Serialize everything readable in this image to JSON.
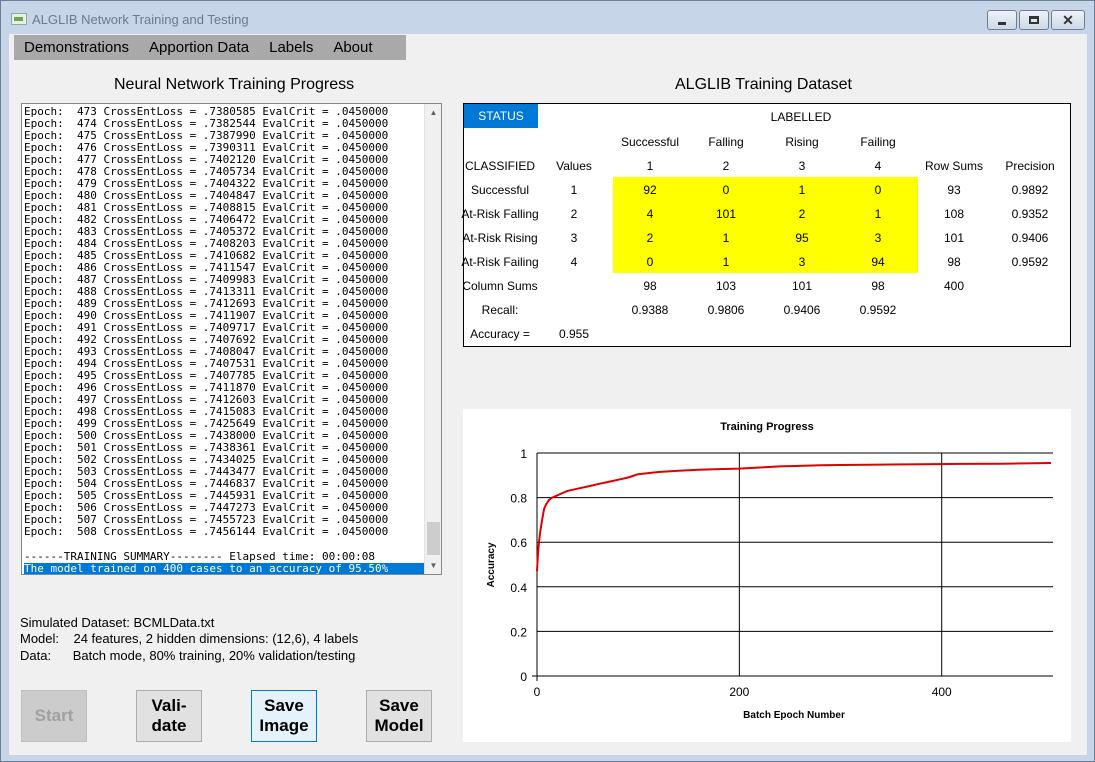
{
  "window": {
    "title": "ALGLIB Network Training and Testing"
  },
  "menu": [
    "Demonstrations",
    "Apportion Data",
    "Labels",
    "About"
  ],
  "left_heading": "Neural Network Training Progress",
  "right_heading": "ALGLIB Training Dataset",
  "log": {
    "lines": [
      "Epoch:  473 CrossEntLoss = .7380585 EvalCrit = .0450000",
      "Epoch:  474 CrossEntLoss = .7382544 EvalCrit = .0450000",
      "Epoch:  475 CrossEntLoss = .7387990 EvalCrit = .0450000",
      "Epoch:  476 CrossEntLoss = .7390311 EvalCrit = .0450000",
      "Epoch:  477 CrossEntLoss = .7402120 EvalCrit = .0450000",
      "Epoch:  478 CrossEntLoss = .7405734 EvalCrit = .0450000",
      "Epoch:  479 CrossEntLoss = .7404322 EvalCrit = .0450000",
      "Epoch:  480 CrossEntLoss = .7404847 EvalCrit = .0450000",
      "Epoch:  481 CrossEntLoss = .7408815 EvalCrit = .0450000",
      "Epoch:  482 CrossEntLoss = .7406472 EvalCrit = .0450000",
      "Epoch:  483 CrossEntLoss = .7405372 EvalCrit = .0450000",
      "Epoch:  484 CrossEntLoss = .7408203 EvalCrit = .0450000",
      "Epoch:  485 CrossEntLoss = .7410682 EvalCrit = .0450000",
      "Epoch:  486 CrossEntLoss = .7411547 EvalCrit = .0450000",
      "Epoch:  487 CrossEntLoss = .7409983 EvalCrit = .0450000",
      "Epoch:  488 CrossEntLoss = .7413311 EvalCrit = .0450000",
      "Epoch:  489 CrossEntLoss = .7412693 EvalCrit = .0450000",
      "Epoch:  490 CrossEntLoss = .7411907 EvalCrit = .0450000",
      "Epoch:  491 CrossEntLoss = .7409717 EvalCrit = .0450000",
      "Epoch:  492 CrossEntLoss = .7407692 EvalCrit = .0450000",
      "Epoch:  493 CrossEntLoss = .7408047 EvalCrit = .0450000",
      "Epoch:  494 CrossEntLoss = .7407531 EvalCrit = .0450000",
      "Epoch:  495 CrossEntLoss = .7407785 EvalCrit = .0450000",
      "Epoch:  496 CrossEntLoss = .7411870 EvalCrit = .0450000",
      "Epoch:  497 CrossEntLoss = .7412603 EvalCrit = .0450000",
      "Epoch:  498 CrossEntLoss = .7415083 EvalCrit = .0450000",
      "Epoch:  499 CrossEntLoss = .7425649 EvalCrit = .0450000",
      "Epoch:  500 CrossEntLoss = .7438000 EvalCrit = .0450000",
      "Epoch:  501 CrossEntLoss = .7438361 EvalCrit = .0450000",
      "Epoch:  502 CrossEntLoss = .7434025 EvalCrit = .0450000",
      "Epoch:  503 CrossEntLoss = .7443477 EvalCrit = .0450000",
      "Epoch:  504 CrossEntLoss = .7446837 EvalCrit = .0450000",
      "Epoch:  505 CrossEntLoss = .7445931 EvalCrit = .0450000",
      "Epoch:  506 CrossEntLoss = .7447273 EvalCrit = .0450000",
      "Epoch:  507 CrossEntLoss = .7455723 EvalCrit = .0450000",
      "Epoch:  508 CrossEntLoss = .7456144 EvalCrit = .0450000"
    ],
    "summary": "------TRAINING SUMMARY-------- Elapsed time: 00:00:08",
    "selected": "The model trained on 400 cases to an accuracy of 95.50%"
  },
  "info": {
    "dataset": "Simulated Dataset: BCMLData.txt",
    "model": "Model:    24 features, 2 hidden dimensions: (12,6), 4 labels",
    "data": "Data:      Batch mode, 80% training, 20% validation/testing"
  },
  "buttons": {
    "start": "Start",
    "validate": [
      "Vali-",
      "date"
    ],
    "save_image": [
      "Save",
      "Image"
    ],
    "save_model": [
      "Save",
      "Model"
    ]
  },
  "matrix": {
    "status": "STATUS",
    "labelled": "LABELLED",
    "classified": "CLASSIFIED",
    "values_header": "Values",
    "column_names": [
      "Successful",
      "Falling",
      "Rising",
      "Failing"
    ],
    "column_values": [
      "1",
      "2",
      "3",
      "4"
    ],
    "row_sums_header": "Row Sums",
    "precision_header": "Precision",
    "rows": [
      {
        "label": "Successful",
        "value": "1",
        "cells": [
          "92",
          "0",
          "1",
          "0"
        ],
        "row_sum": "93",
        "precision": "0.9892"
      },
      {
        "label": "At-Risk Falling",
        "value": "2",
        "cells": [
          "4",
          "101",
          "2",
          "1"
        ],
        "row_sum": "108",
        "precision": "0.9352"
      },
      {
        "label": "At-Risk Rising",
        "value": "3",
        "cells": [
          "2",
          "1",
          "95",
          "3"
        ],
        "row_sum": "101",
        "precision": "0.9406"
      },
      {
        "label": "At-Risk Failing",
        "value": "4",
        "cells": [
          "0",
          "1",
          "3",
          "94"
        ],
        "row_sum": "98",
        "precision": "0.9592"
      }
    ],
    "column_sums_label": "Column Sums",
    "column_sums": [
      "98",
      "103",
      "101",
      "98"
    ],
    "column_sums_total": "400",
    "recall_label": "Recall:",
    "recall": [
      "0.9388",
      "0.9806",
      "0.9406",
      "0.9592"
    ],
    "accuracy_label": "Accuracy =",
    "accuracy": "0.955",
    "highlight_color": "#ffff00"
  },
  "chart_data": {
    "type": "line",
    "title": "Training Progress",
    "xlabel": "Batch Epoch Number",
    "ylabel": "Accuracy",
    "xlim": [
      0,
      510
    ],
    "ylim": [
      0,
      1
    ],
    "x_ticks": [
      0,
      200,
      400
    ],
    "y_ticks": [
      0,
      0.2,
      0.4,
      0.6,
      0.8,
      1
    ],
    "y_tick_labels": [
      "0",
      "0.2",
      "0.4",
      "0.6",
      "0.8",
      "1"
    ],
    "grid": true,
    "series": [
      {
        "color": "#e00000",
        "x": [
          0,
          1,
          2,
          3,
          5,
          7,
          9,
          12,
          15,
          20,
          25,
          30,
          40,
          50,
          60,
          70,
          80,
          90,
          100,
          120,
          140,
          160,
          180,
          200,
          220,
          240,
          260,
          280,
          300,
          340,
          380,
          420,
          460,
          508
        ],
        "y": [
          0.47,
          0.55,
          0.6,
          0.64,
          0.7,
          0.75,
          0.77,
          0.79,
          0.8,
          0.81,
          0.82,
          0.83,
          0.84,
          0.85,
          0.86,
          0.87,
          0.88,
          0.89,
          0.905,
          0.915,
          0.92,
          0.925,
          0.928,
          0.93,
          0.935,
          0.94,
          0.942,
          0.945,
          0.946,
          0.948,
          0.95,
          0.951,
          0.952,
          0.955
        ]
      }
    ]
  }
}
